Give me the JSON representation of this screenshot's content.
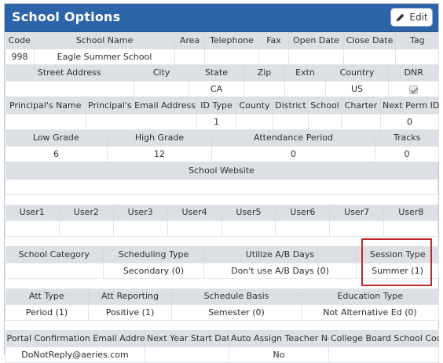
{
  "window": {
    "title": "School Options",
    "edit_label": "Edit",
    "edit_icon": "pencil-icon"
  },
  "row1": {
    "headers": [
      "Code",
      "School Name",
      "Area",
      "Telephone",
      "Fax",
      "Open Date",
      "Close Date",
      "Tag"
    ],
    "values": [
      "998",
      "Eagle Summer School",
      "",
      "",
      "",
      "",
      "",
      ""
    ]
  },
  "row2": {
    "headers": [
      "Street Address",
      "City",
      "State",
      "Zip",
      "Extn",
      "Country",
      "DNR"
    ],
    "values": [
      "",
      "",
      "CA",
      "",
      "",
      "US",
      ""
    ],
    "dnr_checked": true
  },
  "row3": {
    "headers": [
      "Principal's Name",
      "Principal's Email Address",
      "ID Type",
      "County",
      "District",
      "School",
      "Charter",
      "Next Perm ID"
    ],
    "values": [
      "",
      "",
      "1",
      "",
      "",
      "",
      "",
      "0"
    ]
  },
  "row4": {
    "headers": [
      "Low Grade",
      "High Grade",
      "Attendance Period",
      "Tracks"
    ],
    "values": [
      "6",
      "12",
      "0",
      "0"
    ]
  },
  "row5": {
    "headers": [
      "School Website"
    ],
    "values": [
      ""
    ]
  },
  "row6": {
    "headers": [
      "User1",
      "User2",
      "User3",
      "User4",
      "User5",
      "User6",
      "User7",
      "User8"
    ],
    "values": [
      "",
      "",
      "",
      "",
      "",
      "",
      "",
      ""
    ]
  },
  "row7": {
    "headers": [
      "School Category",
      "Scheduling Type",
      "Utilize A/B Days",
      "Session Type"
    ],
    "values": [
      "",
      "Secondary (0)",
      "Don't use A/B Days (0)",
      "Summer (1)"
    ]
  },
  "row8": {
    "headers": [
      "Att Type",
      "Att Reporting",
      "Schedule Basis",
      "Education Type"
    ],
    "values": [
      "Period (1)",
      "Positive (1)",
      "Semester (0)",
      "Not Alternative Ed (0)"
    ]
  },
  "row9": {
    "headers": [
      "Portal Confirmation Email Address",
      "Next Year Start Date",
      "Auto Assign Teacher No.",
      "College Board School Code"
    ],
    "values": [
      "DoNotReply@aeries.com",
      "",
      "No",
      ""
    ]
  },
  "colors": {
    "title_bar": "#2d64a8",
    "header_row": "#dce0e5",
    "highlight": "#c0262c"
  }
}
